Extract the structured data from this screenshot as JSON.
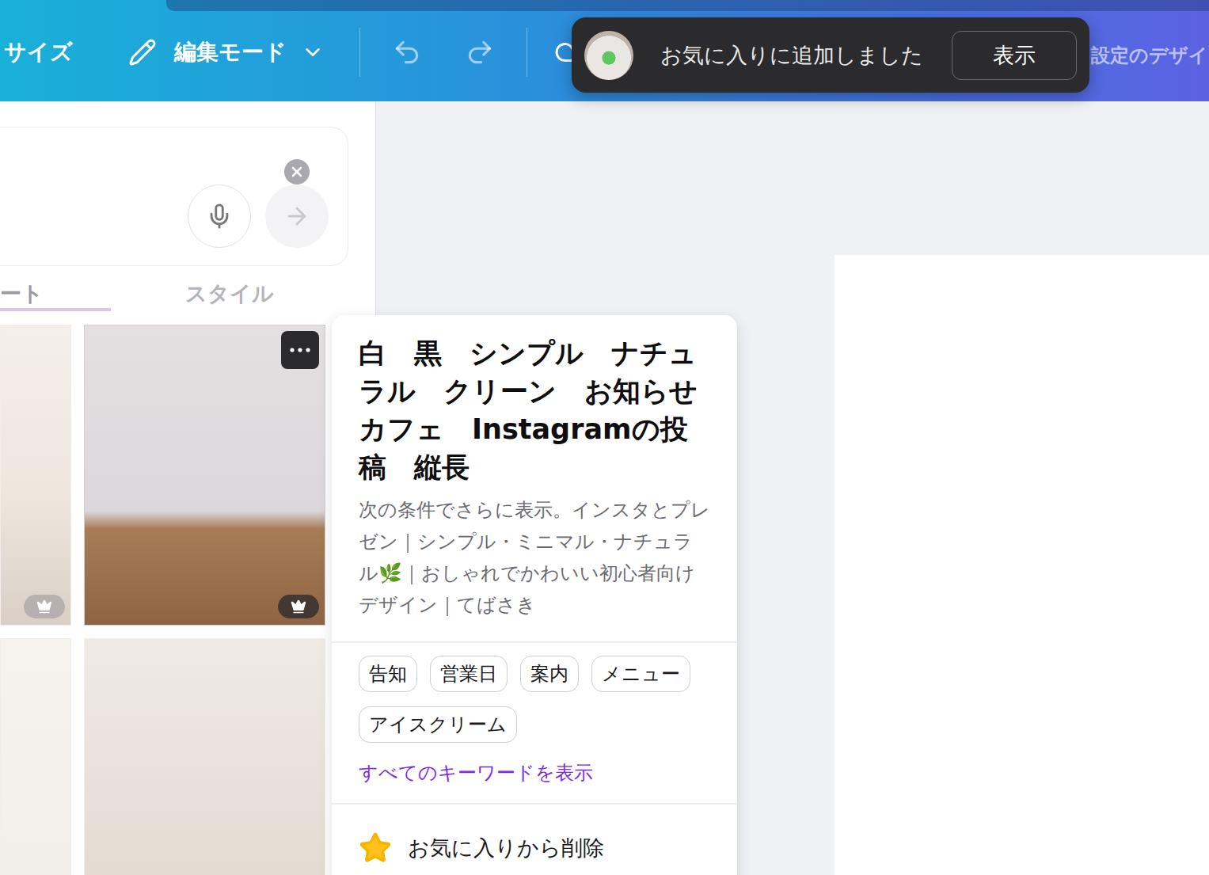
{
  "toolbar": {
    "resize": "サイズ",
    "mode": "編集モード",
    "right_label": "設定のデザイ"
  },
  "toast": {
    "message": "お気に入りに追加しました",
    "button": "表示"
  },
  "tabs": [
    {
      "label": "ート",
      "selected": true
    },
    {
      "label": "スタイル",
      "selected": false
    }
  ],
  "templates": [
    {
      "kind": "latte",
      "premium": true,
      "menu": false,
      "hovered": false
    },
    {
      "kind": "soda",
      "premium": true,
      "menu": true,
      "hovered": true
    },
    {
      "kind": "paper",
      "premium": false,
      "menu": false,
      "hovered": false
    },
    {
      "kind": "polaroid",
      "premium": false,
      "menu": false,
      "hovered": false
    }
  ],
  "popover": {
    "title": "白　黒　シンプル　ナチュラル　クリーン　お知らせ　カフェ　Instagramの投稿　縦長",
    "description": "次の条件でさらに表示。インスタとプレゼン｜シンプル・ミニマル・ナチュラル🌿｜おしゃれでかわいい初心者向けデザイン｜てばさき",
    "tags": [
      "告知",
      "営業日",
      "案内",
      "メニュー",
      "アイスクリーム"
    ],
    "all_keywords": "すべてのキーワードを表示",
    "favorite_action": "お気に入りから削除",
    "favorited": true
  }
}
